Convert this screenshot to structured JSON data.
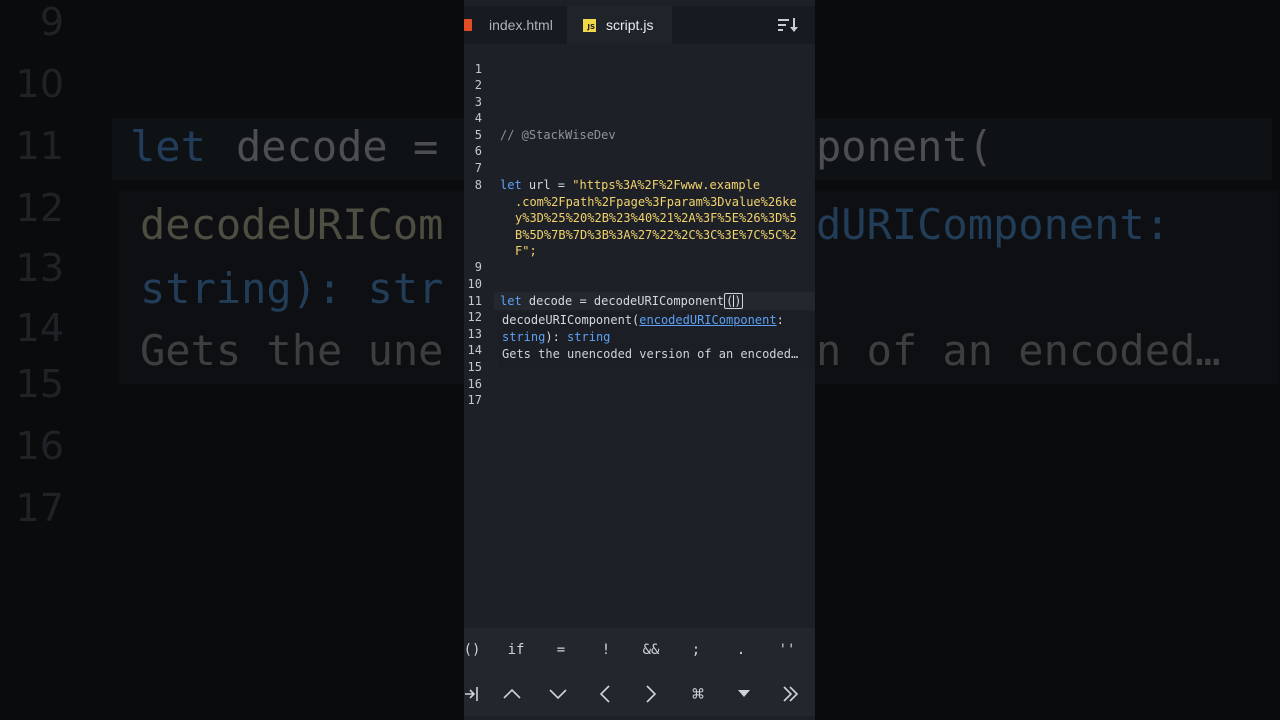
{
  "background": {
    "line_numbers": [
      "9",
      "10",
      "11",
      "12",
      "13",
      "14",
      "15",
      "16",
      "17"
    ],
    "code_let": "let",
    "code_decode": "decode =",
    "code_ponent": "ponent(",
    "code_close": ")",
    "popup_sig_left": "decodeURICom",
    "popup_sig_right": "dURIComponent:",
    "popup_type_left": "string):  str",
    "popup_desc_left": "Gets the une",
    "popup_desc_right": "n of an encoded…"
  },
  "tabs": [
    {
      "label": "index.html",
      "icon": "html5-icon"
    },
    {
      "label": "script.js",
      "icon": "js-icon",
      "active": true
    }
  ],
  "editor": {
    "line_numbers": [
      "1",
      "2",
      "3",
      "4",
      "5",
      "6",
      "7",
      "8",
      "9",
      "10",
      "11",
      "12",
      "13",
      "14",
      "15",
      "16",
      "17"
    ],
    "comment": "// @StackWiseDev",
    "line8_kw": "let",
    "line8_name": " url = ",
    "line8_str": [
      "\"https%3A%2F%2Fwww.example",
      ".com%2Fpath%2Fpage%3Fparam%3Dvalue%26ke",
      "y%3D%25%20%2B%23%40%21%2A%3F%5E%26%3D%5",
      "B%5D%7B%7D%3B%3A%27%22%2C%3C%3E%7C%5C%2",
      "F\";"
    ],
    "line11_kw": "let",
    "line11_name": " decode = decodeURIComponent",
    "line11_open": "(",
    "line11_close": ")"
  },
  "hint": {
    "fn": "decodeURIComponent(",
    "param": "encodedURIComponent",
    "colon": ":",
    "type1": "string",
    "ret": "): ",
    "type2": "string",
    "desc": "Gets the unencoded version of an encoded…"
  },
  "keys_row1": [
    "()",
    "if",
    "=",
    "!",
    "&&",
    ";",
    ".",
    "''"
  ],
  "keys_row2_icons": [
    "tab-icon",
    "arrow-up-icon",
    "arrow-down-icon",
    "arrow-left-icon",
    "arrow-right-icon",
    "command-icon",
    "dropdown-icon",
    "fast-forward-icon"
  ]
}
